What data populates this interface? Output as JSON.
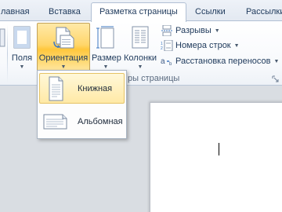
{
  "tabs": [
    {
      "label": "лавная"
    },
    {
      "label": "Вставка"
    },
    {
      "label": "Разметка страницы",
      "active": true
    },
    {
      "label": "Ссылки"
    },
    {
      "label": "Рассылки"
    }
  ],
  "ribbon": {
    "buttons": {
      "margins": "Поля",
      "orientation": "Ориентация",
      "size": "Размер",
      "columns": "Колонки"
    },
    "small_buttons": {
      "breaks": "Разрывы",
      "line_numbers": "Номера строк",
      "hyphenation": "Расстановка переносов"
    },
    "group_label": "ры страницы"
  },
  "orientation_menu": {
    "items": [
      {
        "label": "Книжная",
        "icon": "portrait-page-icon",
        "highlighted": true
      },
      {
        "label": "Альбомная",
        "icon": "landscape-page-icon",
        "highlighted": false
      }
    ]
  },
  "colors": {
    "accent_pressed": "#ffd66b",
    "text": "#1e395b"
  }
}
